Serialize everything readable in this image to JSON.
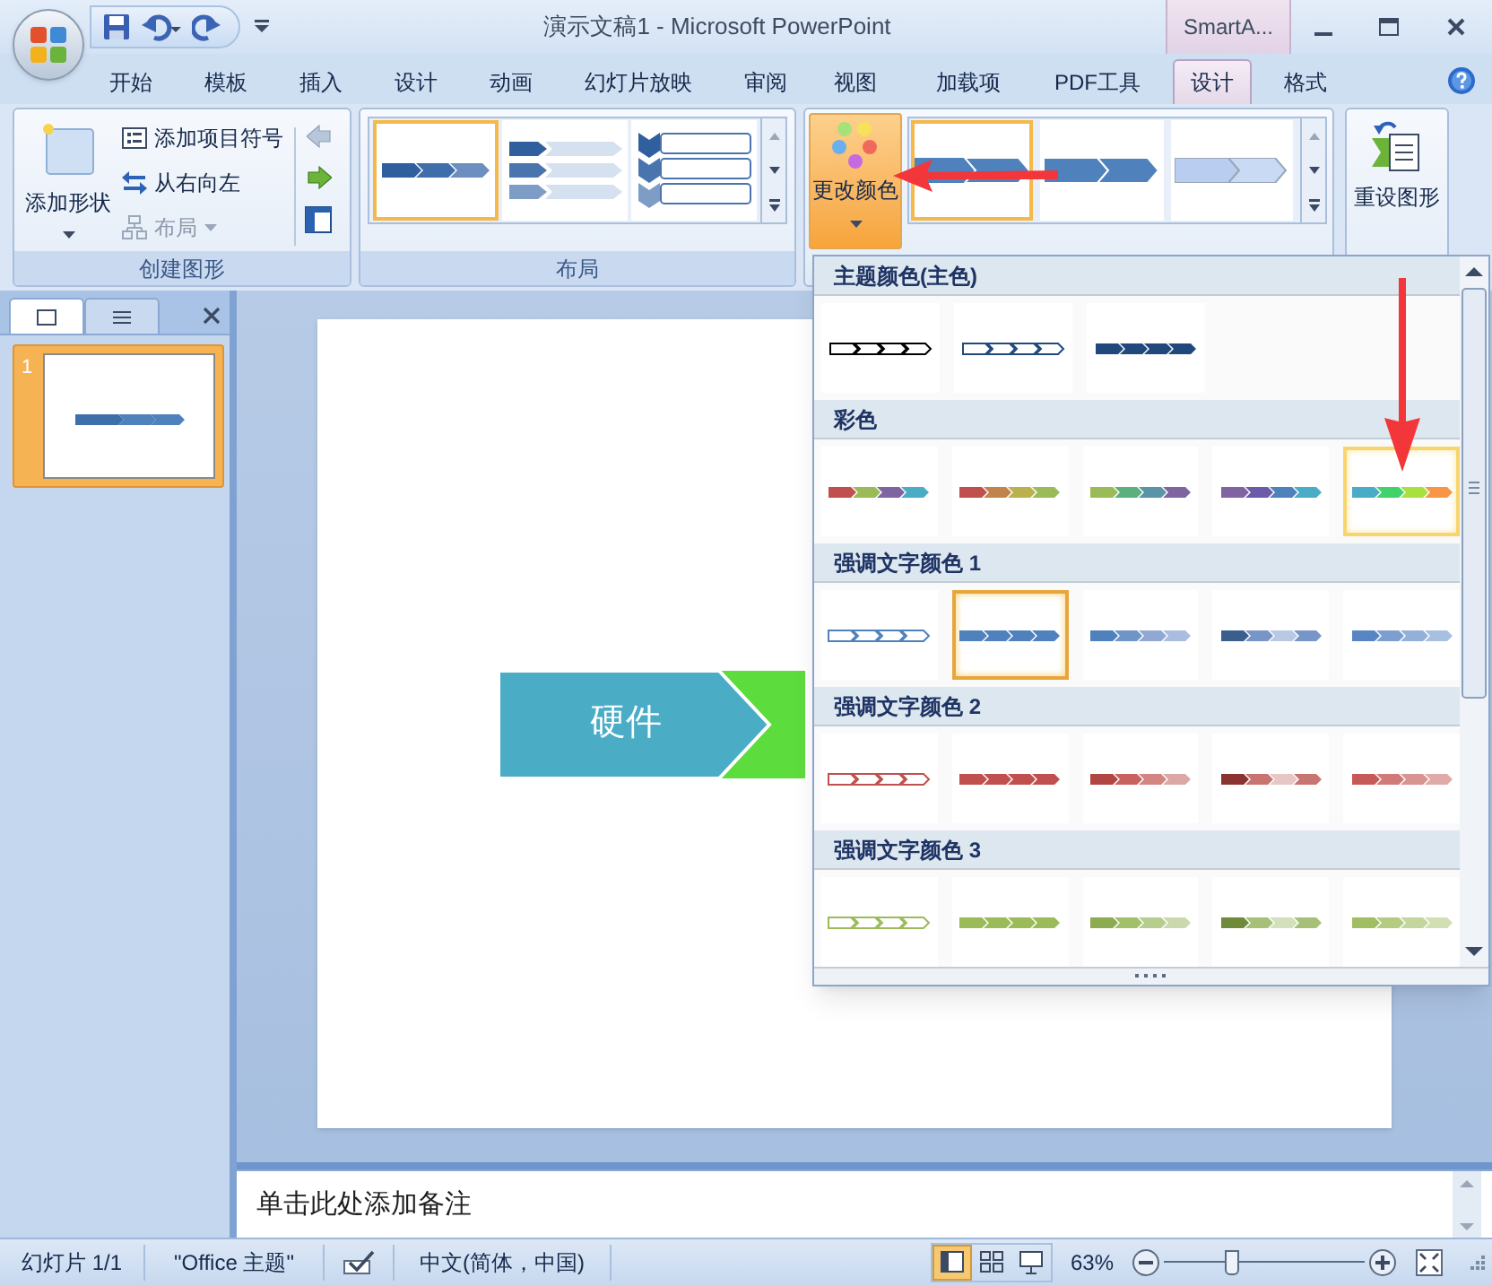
{
  "title_bar": {
    "title": "演示文稿1 - Microsoft PowerPoint",
    "context_tab": "SmartA..."
  },
  "tabs": [
    {
      "label": "开始",
      "selected": false
    },
    {
      "label": "模板",
      "selected": false
    },
    {
      "label": "插入",
      "selected": false
    },
    {
      "label": "设计",
      "selected": false
    },
    {
      "label": "动画",
      "selected": false
    },
    {
      "label": "幻灯片放映",
      "selected": false
    },
    {
      "label": "审阅",
      "selected": false
    },
    {
      "label": "视图",
      "selected": false
    },
    {
      "label": "加载项",
      "selected": false
    },
    {
      "label": "PDF工具",
      "selected": false
    },
    {
      "label": "设计",
      "selected": true
    },
    {
      "label": "格式",
      "selected": false
    }
  ],
  "ribbon": {
    "create_graphic": {
      "label": "创建图形",
      "add_shape": "添加形状",
      "commands": [
        {
          "kind": "bullet",
          "label": "添加项目符号",
          "disabled": false
        },
        {
          "kind": "rtl",
          "label": "从右向左",
          "disabled": false
        },
        {
          "kind": "layout",
          "label": "布局",
          "disabled": true
        }
      ]
    },
    "layouts": {
      "label": "布局",
      "items": [
        {
          "kind": "basic",
          "selected": true
        },
        {
          "kind": "stacked",
          "selected": false
        },
        {
          "kind": "vertical",
          "selected": false
        }
      ]
    },
    "styles": {
      "change_colors": "更改颜色",
      "items": [
        {
          "kind": "flat",
          "selected": true
        },
        {
          "kind": "bevel",
          "selected": false
        },
        {
          "kind": "light",
          "selected": false
        }
      ]
    },
    "reset": "重设图形"
  },
  "slides_pane": {
    "tabs": [
      {
        "kind": "slides",
        "selected": true
      },
      {
        "kind": "outline",
        "selected": false
      }
    ],
    "slides": [
      {
        "number": "1",
        "selected": true
      }
    ]
  },
  "slide": {
    "shapes": [
      {
        "text": "硬件",
        "color": "#4bacc6"
      },
      {
        "color": "#5ddc3e"
      }
    ]
  },
  "notes": {
    "placeholder": "单击此处添加备注"
  },
  "color_menu": {
    "sections": [
      {
        "title": "主题颜色(主色)",
        "items": [
          {
            "kind": "outline",
            "segments": [
              {
                "color": "#000000"
              },
              {
                "color": "#000000"
              },
              {
                "color": "#000000"
              },
              {
                "color": "#000000"
              }
            ],
            "selected": false,
            "hovered": false
          },
          {
            "kind": "outline",
            "segments": [
              {
                "color": "#1f497d"
              },
              {
                "color": "#1f497d"
              },
              {
                "color": "#1f497d"
              },
              {
                "color": "#1f497d"
              }
            ],
            "selected": false,
            "hovered": false
          },
          {
            "kind": "filled",
            "segments": [
              {
                "color": "#1f497d"
              },
              {
                "color": "#1f497d"
              },
              {
                "color": "#1f497d"
              },
              {
                "color": "#1f497d"
              }
            ],
            "selected": false,
            "hovered": false
          }
        ]
      },
      {
        "title": "彩色",
        "items": [
          {
            "kind": "filled",
            "segments": [
              {
                "color": "#c0504d"
              },
              {
                "color": "#9bbb59"
              },
              {
                "color": "#8064a2"
              },
              {
                "color": "#4bacc6"
              }
            ],
            "selected": false,
            "hovered": false
          },
          {
            "kind": "filled",
            "segments": [
              {
                "color": "#c0504d"
              },
              {
                "color": "#c0844d"
              },
              {
                "color": "#bbb04d"
              },
              {
                "color": "#9bbb59"
              }
            ],
            "selected": false,
            "hovered": false
          },
          {
            "kind": "filled",
            "segments": [
              {
                "color": "#9bbb59"
              },
              {
                "color": "#5bb07d"
              },
              {
                "color": "#5b93a8"
              },
              {
                "color": "#8064a2"
              }
            ],
            "selected": false,
            "hovered": false
          },
          {
            "kind": "filled",
            "segments": [
              {
                "color": "#8064a2"
              },
              {
                "color": "#6c5ba8"
              },
              {
                "color": "#4f81bd"
              },
              {
                "color": "#4bacc6"
              }
            ],
            "selected": false,
            "hovered": false
          },
          {
            "kind": "filled",
            "segments": [
              {
                "color": "#4bacc6"
              },
              {
                "color": "#3fd46a"
              },
              {
                "color": "#a8e040"
              },
              {
                "color": "#f79646"
              }
            ],
            "selected": false,
            "hovered": true
          }
        ]
      },
      {
        "title": "强调文字颜色 1",
        "items": [
          {
            "kind": "outline",
            "segments": [
              {
                "color": "#4f81bd"
              },
              {
                "color": "#4f81bd"
              },
              {
                "color": "#4f81bd"
              },
              {
                "color": "#4f81bd"
              }
            ],
            "selected": false,
            "hovered": false
          },
          {
            "kind": "filled",
            "segments": [
              {
                "color": "#4f81bd"
              },
              {
                "color": "#4f81bd"
              },
              {
                "color": "#4f81bd"
              },
              {
                "color": "#4f81bd"
              }
            ],
            "selected": true,
            "hovered": false
          },
          {
            "kind": "filled",
            "segments": [
              {
                "color": "#4f81bd"
              },
              {
                "color": "#6f95c8"
              },
              {
                "color": "#8fa9d3"
              },
              {
                "color": "#a8bde0"
              }
            ],
            "selected": false,
            "hovered": false
          },
          {
            "kind": "filled",
            "segments": [
              {
                "color": "#3a5f8f"
              },
              {
                "color": "#7795c6"
              },
              {
                "color": "#b9c9e3"
              },
              {
                "color": "#7795c6"
              }
            ],
            "selected": false,
            "hovered": false
          },
          {
            "kind": "filled",
            "segments": [
              {
                "color": "#5886c2"
              },
              {
                "color": "#7d9fd0"
              },
              {
                "color": "#93b0d8"
              },
              {
                "color": "#a8c0e0"
              }
            ],
            "selected": false,
            "hovered": false
          }
        ]
      },
      {
        "title": "强调文字颜色 2",
        "items": [
          {
            "kind": "outline",
            "segments": [
              {
                "color": "#c0504d"
              },
              {
                "color": "#c0504d"
              },
              {
                "color": "#c0504d"
              },
              {
                "color": "#c0504d"
              }
            ],
            "selected": false,
            "hovered": false
          },
          {
            "kind": "filled",
            "segments": [
              {
                "color": "#c0504d"
              },
              {
                "color": "#c0504d"
              },
              {
                "color": "#c0504d"
              },
              {
                "color": "#c0504d"
              }
            ],
            "selected": false,
            "hovered": false
          },
          {
            "kind": "filled",
            "segments": [
              {
                "color": "#b04542"
              },
              {
                "color": "#c8625f"
              },
              {
                "color": "#d28582"
              },
              {
                "color": "#dba8a6"
              }
            ],
            "selected": false,
            "hovered": false
          },
          {
            "kind": "filled",
            "segments": [
              {
                "color": "#8b3330"
              },
              {
                "color": "#c87471"
              },
              {
                "color": "#e7c6c5"
              },
              {
                "color": "#c87471"
              }
            ],
            "selected": false,
            "hovered": false
          },
          {
            "kind": "filled",
            "segments": [
              {
                "color": "#c55a57"
              },
              {
                "color": "#d17b78"
              },
              {
                "color": "#d89491"
              },
              {
                "color": "#e0aaa8"
              }
            ],
            "selected": false,
            "hovered": false
          }
        ]
      },
      {
        "title": "强调文字颜色 3",
        "items": [
          {
            "kind": "outline",
            "segments": [
              {
                "color": "#9bbb59"
              },
              {
                "color": "#9bbb59"
              },
              {
                "color": "#9bbb59"
              },
              {
                "color": "#9bbb59"
              }
            ],
            "selected": false,
            "hovered": false
          },
          {
            "kind": "filled",
            "segments": [
              {
                "color": "#9bbb59"
              },
              {
                "color": "#9bbb59"
              },
              {
                "color": "#9bbb59"
              },
              {
                "color": "#9bbb59"
              }
            ],
            "selected": false,
            "hovered": false
          },
          {
            "kind": "filled",
            "segments": [
              {
                "color": "#8dab4f"
              },
              {
                "color": "#a2bf6a"
              },
              {
                "color": "#b7cd8d"
              },
              {
                "color": "#cad9ad"
              }
            ],
            "selected": false,
            "hovered": false
          },
          {
            "kind": "filled",
            "segments": [
              {
                "color": "#6f8a38"
              },
              {
                "color": "#a7c078"
              },
              {
                "color": "#d3e0bc"
              },
              {
                "color": "#a7c078"
              }
            ],
            "selected": false,
            "hovered": false
          },
          {
            "kind": "filled",
            "segments": [
              {
                "color": "#a1be62"
              },
              {
                "color": "#b5cb82"
              },
              {
                "color": "#c4d59d"
              },
              {
                "color": "#d2dfb3"
              }
            ],
            "selected": false,
            "hovered": false
          }
        ]
      }
    ]
  },
  "status_bar": {
    "slide": "幻灯片 1/1",
    "theme": "\"Office 主题\"",
    "language": "中文(简体，中国)",
    "zoom": "63%",
    "views": [
      {
        "kind": "normal",
        "selected": true
      },
      {
        "kind": "sorter",
        "selected": false
      },
      {
        "kind": "show",
        "selected": false
      }
    ],
    "zoom_slider": {
      "level": 0.33
    }
  }
}
